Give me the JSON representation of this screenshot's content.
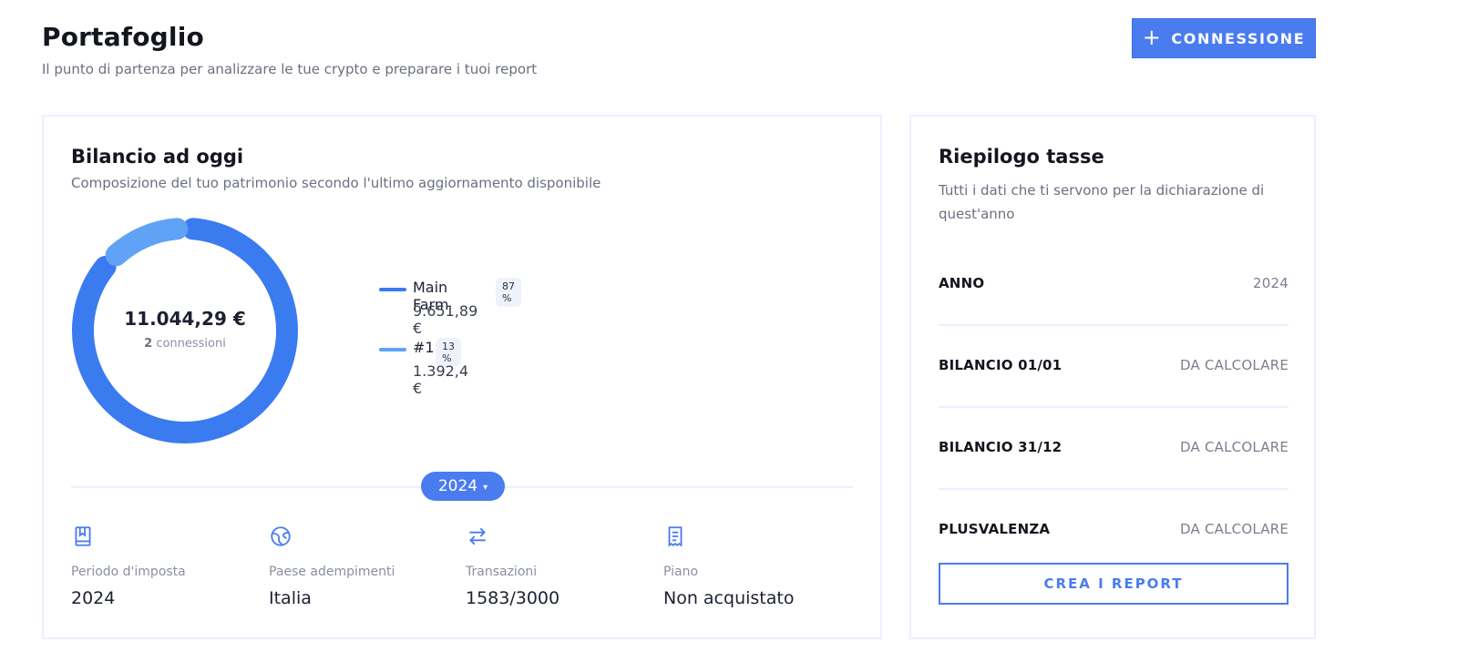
{
  "header": {
    "title": "Portafoglio",
    "subtitle": "Il punto di partenza per analizzare le tue crypto e preparare i tuoi report",
    "add_button_label": "CONNESSIONE"
  },
  "balance": {
    "title": "Bilancio ad oggi",
    "subtitle": "Composizione del tuo patrimonio secondo l'ultimo aggiornamento disponibile",
    "total": "11.044,29 €",
    "connections_count": "2",
    "connections_label": "connessioni",
    "legend": [
      {
        "name": "Main Farm",
        "percent": "87 %",
        "value": "9.651,89 €",
        "color": "#3b7bf0",
        "share": 0.87
      },
      {
        "name": "#1",
        "percent": "13 %",
        "value": "1.392,4 €",
        "color": "#60a2f5",
        "share": 0.13
      }
    ],
    "year_selector": "2024",
    "stats": [
      {
        "icon": "book-icon",
        "label": "Periodo d'imposta",
        "value": "2024"
      },
      {
        "icon": "globe-icon",
        "label": "Paese adempimenti",
        "value": "Italia"
      },
      {
        "icon": "arrows-swap-icon",
        "label": "Transazioni",
        "value": "1583/3000"
      },
      {
        "icon": "receipt-icon",
        "label": "Piano",
        "value": "Non acquistato"
      }
    ]
  },
  "taxes": {
    "title": "Riepilogo tasse",
    "subtitle": "Tutti i dati che ti servono per la dichiarazione di quest'anno",
    "rows": [
      {
        "label": "ANNO",
        "value": "2024"
      },
      {
        "label": "BILANCIO 01/01",
        "value": "DA CALCOLARE"
      },
      {
        "label": "BILANCIO 31/12",
        "value": "DA CALCOLARE"
      },
      {
        "label": "PLUSVALENZA",
        "value": "DA CALCOLARE"
      }
    ],
    "report_button_label": "CREA I REPORT"
  },
  "colors": {
    "accent": "#4a7cf0",
    "card_border": "#eaf1fd"
  }
}
